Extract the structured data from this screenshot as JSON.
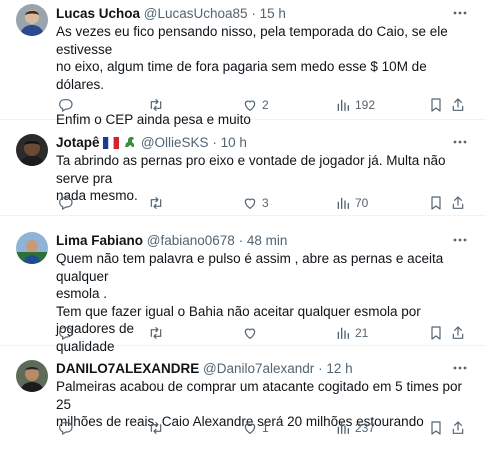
{
  "tweets": [
    {
      "name": "Lucas Uchoa",
      "handle": "@LucasUchoa85",
      "separator": "·",
      "time": "15 h",
      "lines": [
        "As vezes eu fico pensando nisso, pela temporada do Caio, se ele estivesse",
        "no eixo, algum time de fora pagaria sem medo esse $ 10M de dólares.",
        "Enfim o CEP ainda pesa e muito"
      ],
      "replies": "",
      "retweets": "",
      "likes": "2",
      "views": "192"
    },
    {
      "name": "Jotapê",
      "handle": "@OllieSKS",
      "separator": "·",
      "time": "10 h",
      "lines": [
        "Ta abrindo as pernas pro eixo e vontade de jogador já. Multa não serve pra",
        "nada mesmo."
      ],
      "replies": "",
      "retweets": "",
      "likes": "3",
      "views": "70"
    },
    {
      "name": "Lima Fabiano",
      "handle": "@fabiano0678",
      "separator": "·",
      "time": "48 min",
      "lines": [
        "Quem não tem palavra e pulso é assim , abre as pernas e aceita qualquer",
        "esmola .",
        "Tem que fazer igual o Bahia não aceitar qualquer esmola por jogadores de",
        "qualidade"
      ],
      "replies": "",
      "retweets": "",
      "likes": "",
      "views": "21"
    },
    {
      "name": "DANILO7ALEXANDRE",
      "handle": "@Danilo7alexandr",
      "separator": "·",
      "time": "12 h",
      "lines": [
        "Palmeiras acabou de comprar um atacante cogitado em 5 times por 25",
        "milhões de reais. Caio Alexandre será 20 milhões estourando"
      ],
      "replies": "",
      "retweets": "",
      "likes": "1",
      "views": "237"
    }
  ],
  "icons": {
    "more": "more-icon",
    "reply": "reply-icon",
    "retweet": "retweet-icon",
    "like": "heart-icon",
    "views": "views-chart-icon",
    "bookmark": "bookmark-icon",
    "share": "share-icon"
  },
  "colors": {
    "text": "#0f1419",
    "secondary": "#536471",
    "divider": "#eff3f4"
  }
}
